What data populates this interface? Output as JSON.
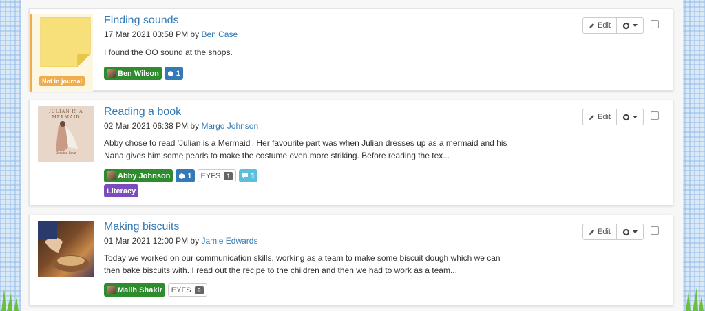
{
  "cards": [
    {
      "title": "Finding sounds",
      "date": "17 Mar 2021 03:58 PM by",
      "author": "Ben Case",
      "description": "I found the OO sound at the shops.",
      "badge": "Not in journal",
      "child": "Ben Wilson",
      "media_count": "1",
      "edit_label": "Edit"
    },
    {
      "title": "Reading a book",
      "date": "02 Mar 2021 06:38 PM by",
      "author": "Margo Johnson",
      "description": "Abby chose to read 'Julian is a Mermaid'. Her favourite part was when Julian dresses up as a mermaid and his Nana gives him some pearls to make the costume even more striking. Before reading the tex...",
      "book_title": "JULIAN IS A MERMAID",
      "book_author": "Jessica Love",
      "child": "Abby Johnson",
      "media_count": "1",
      "eyfs_label": "EYFS",
      "eyfs_count": "1",
      "comment_count": "1",
      "subject_tag": "Literacy",
      "edit_label": "Edit"
    },
    {
      "title": "Making biscuits",
      "date": "01 Mar 2021 12:00 PM by",
      "author": "Jamie Edwards",
      "description": "Today we worked on our communication skills, working as a team to make some biscuit dough which we can then bake biscuits with. I read out the recipe to the children and then we had to work as a team...",
      "child": "Malih Shakir",
      "eyfs_label": "EYFS",
      "eyfs_count": "6",
      "edit_label": "Edit"
    }
  ],
  "icons": {
    "edit": "pencil-icon",
    "settings": "gear-icon",
    "media": "cube-icon",
    "comment": "speech-bubble-icon"
  },
  "colors": {
    "link": "#337ab7",
    "child_tag": "#2e8b2e",
    "media_tag": "#337ab7",
    "comment_tag": "#5bc0de",
    "subject_tag": "#7b4cbc",
    "not_in_journal": "#f0ad4e"
  }
}
